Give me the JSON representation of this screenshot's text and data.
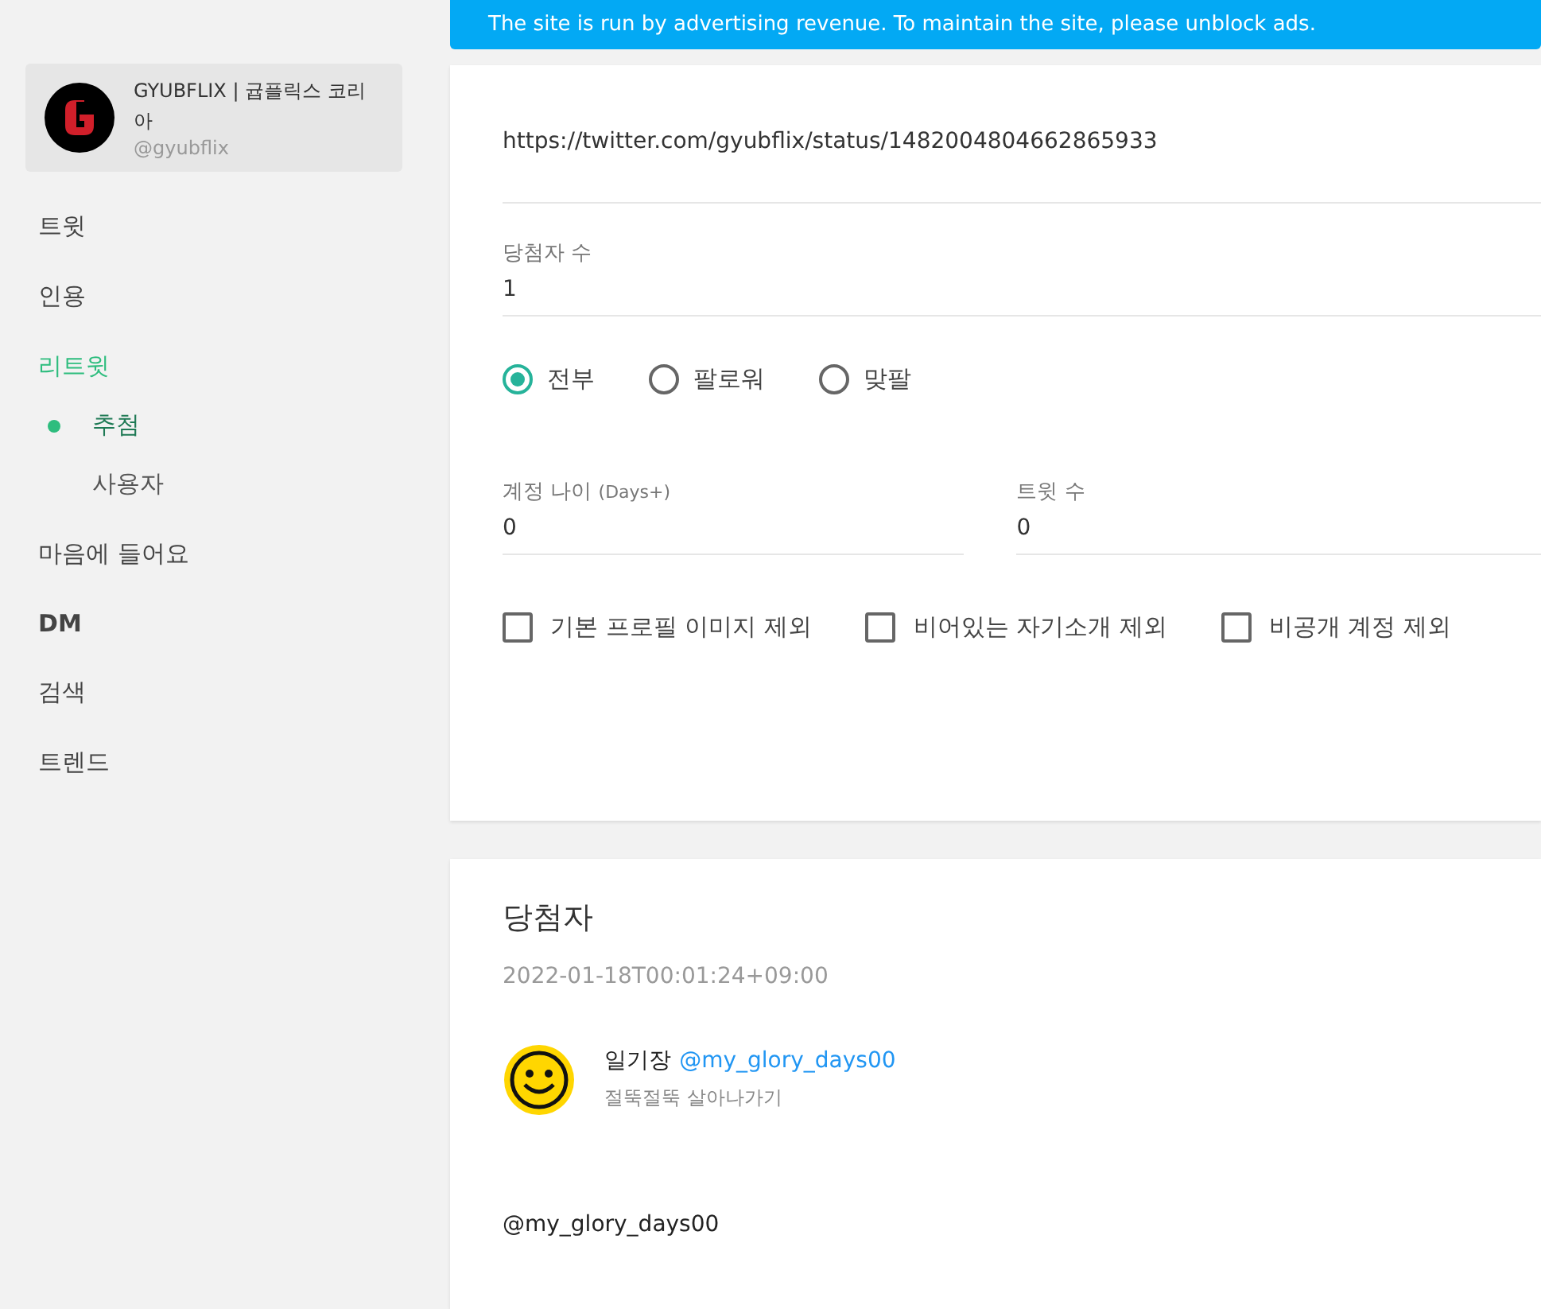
{
  "profile": {
    "name": "GYUBFLIX | 귭플릭스 코리아",
    "handle": "@gyubflix"
  },
  "nav": [
    {
      "label": "트윗",
      "selected": false
    },
    {
      "label": "인용",
      "selected": false
    },
    {
      "label": "리트윗",
      "selected": true,
      "children": [
        {
          "label": "추첨",
          "selected": true
        },
        {
          "label": "사용자",
          "selected": false
        }
      ]
    },
    {
      "label": "마음에 들어요",
      "selected": false
    },
    {
      "label": "DM",
      "selected": false
    },
    {
      "label": "검색",
      "selected": false
    },
    {
      "label": "트렌드",
      "selected": false
    }
  ],
  "banner": "The site is run by advertising revenue. To maintain the site, please unblock ads.",
  "form": {
    "url": "https://twitter.com/gyubflix/status/1482004804662865933",
    "winners_count": {
      "label": "당첨자 수",
      "value": "1"
    },
    "audience": [
      {
        "label": "전부",
        "selected": true
      },
      {
        "label": "팔로워",
        "selected": false
      },
      {
        "label": "맞팔",
        "selected": false
      }
    ],
    "account_age": {
      "label": "계정 나이",
      "hint": "(Days+)",
      "value": "0"
    },
    "tweet_count": {
      "label": "트윗 수",
      "value": "0"
    },
    "filters": [
      {
        "label": "기본 프로필 이미지 제외",
        "checked": false
      },
      {
        "label": "비어있는 자기소개 제외",
        "checked": false
      },
      {
        "label": "비공개 계정 제외",
        "checked": false
      }
    ]
  },
  "winners": {
    "title": "당첨자",
    "timestamp": "2022-01-18T00:01:24+09:00",
    "items": [
      {
        "name": "일기장",
        "handle": "@my_glory_days00",
        "bio": "절뚝절뚝 살아나가기"
      }
    ],
    "mention": "@my_glory_days00"
  }
}
